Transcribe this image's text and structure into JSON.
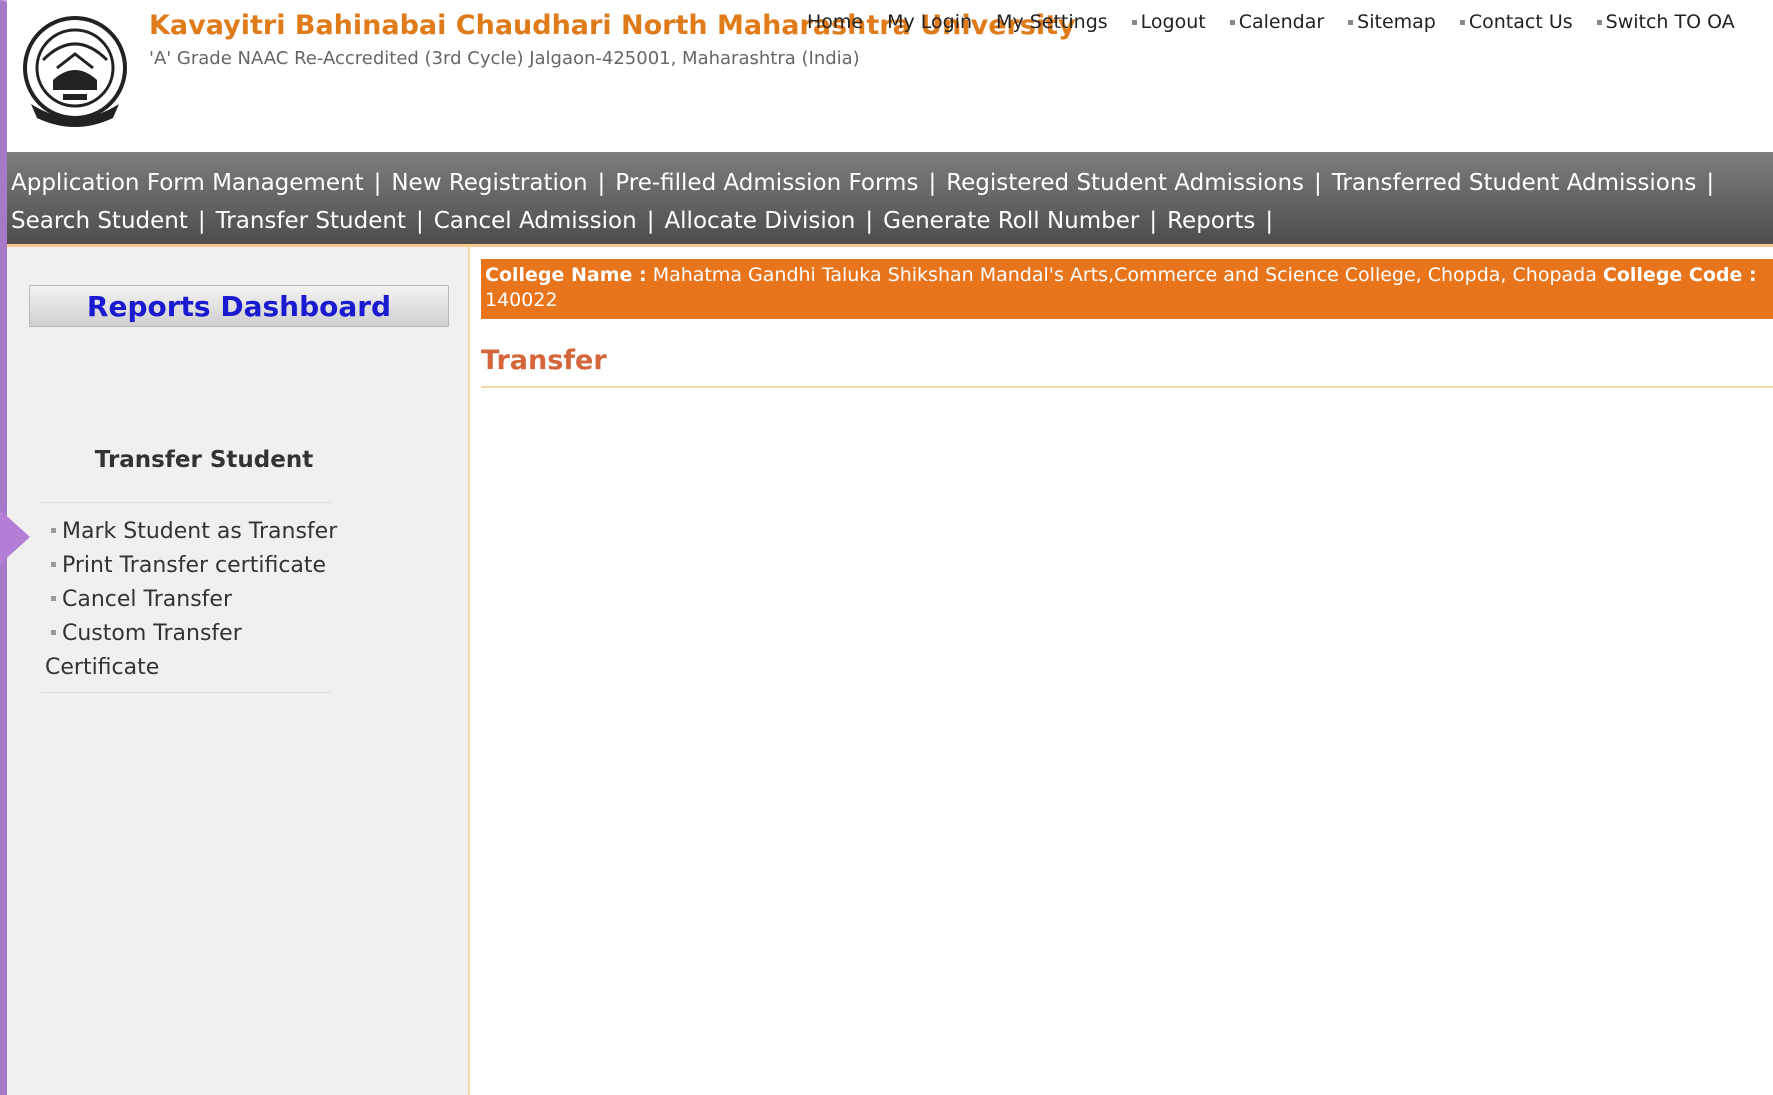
{
  "header": {
    "university_title": "Kavayitri Bahinabai Chaudhari North Maharashtra University",
    "subtitle": "'A' Grade NAAC Re-Accredited (3rd Cycle) Jalgaon-425001, Maharashtra (India)",
    "logo_icon": "university-seal-icon"
  },
  "top_links": [
    "Home",
    "My Login",
    "My Settings",
    "Logout",
    "Calendar",
    "Sitemap",
    "Contact Us",
    "Switch TO OA"
  ],
  "nav": {
    "row1": [
      "Application Form Management",
      "New Registration",
      "Pre-filled Admission Forms",
      "Registered Student Admissions",
      "Transferred Student Admissions"
    ],
    "row2": [
      "Search Student",
      "Transfer Student",
      "Cancel Admission",
      "Allocate Division",
      "Generate Roll Number",
      "Reports"
    ]
  },
  "sidebar": {
    "dashboard_button": "Reports Dashboard",
    "heading": "Transfer Student",
    "items": [
      "Mark Student as Transfer",
      "Print Transfer certificate",
      "Cancel Transfer",
      "Custom Transfer Certificate"
    ]
  },
  "content": {
    "college_name_label": "College Name :",
    "college_name": "Mahatma Gandhi Taluka Shikshan Mandal's Arts,Commerce and Science College, Chopda, Chopada",
    "college_code_label": "College Code :",
    "college_code": "140022",
    "title": "Transfer"
  },
  "colors": {
    "brand_orange": "#e07b1a",
    "college_bar": "#e8741c",
    "nav_bar_top": "#7d7d7d",
    "nav_bar_bottom": "#4d4d4d",
    "dashboard_text": "#1a1ad1",
    "pointer_arrow": "#b57ed6"
  }
}
